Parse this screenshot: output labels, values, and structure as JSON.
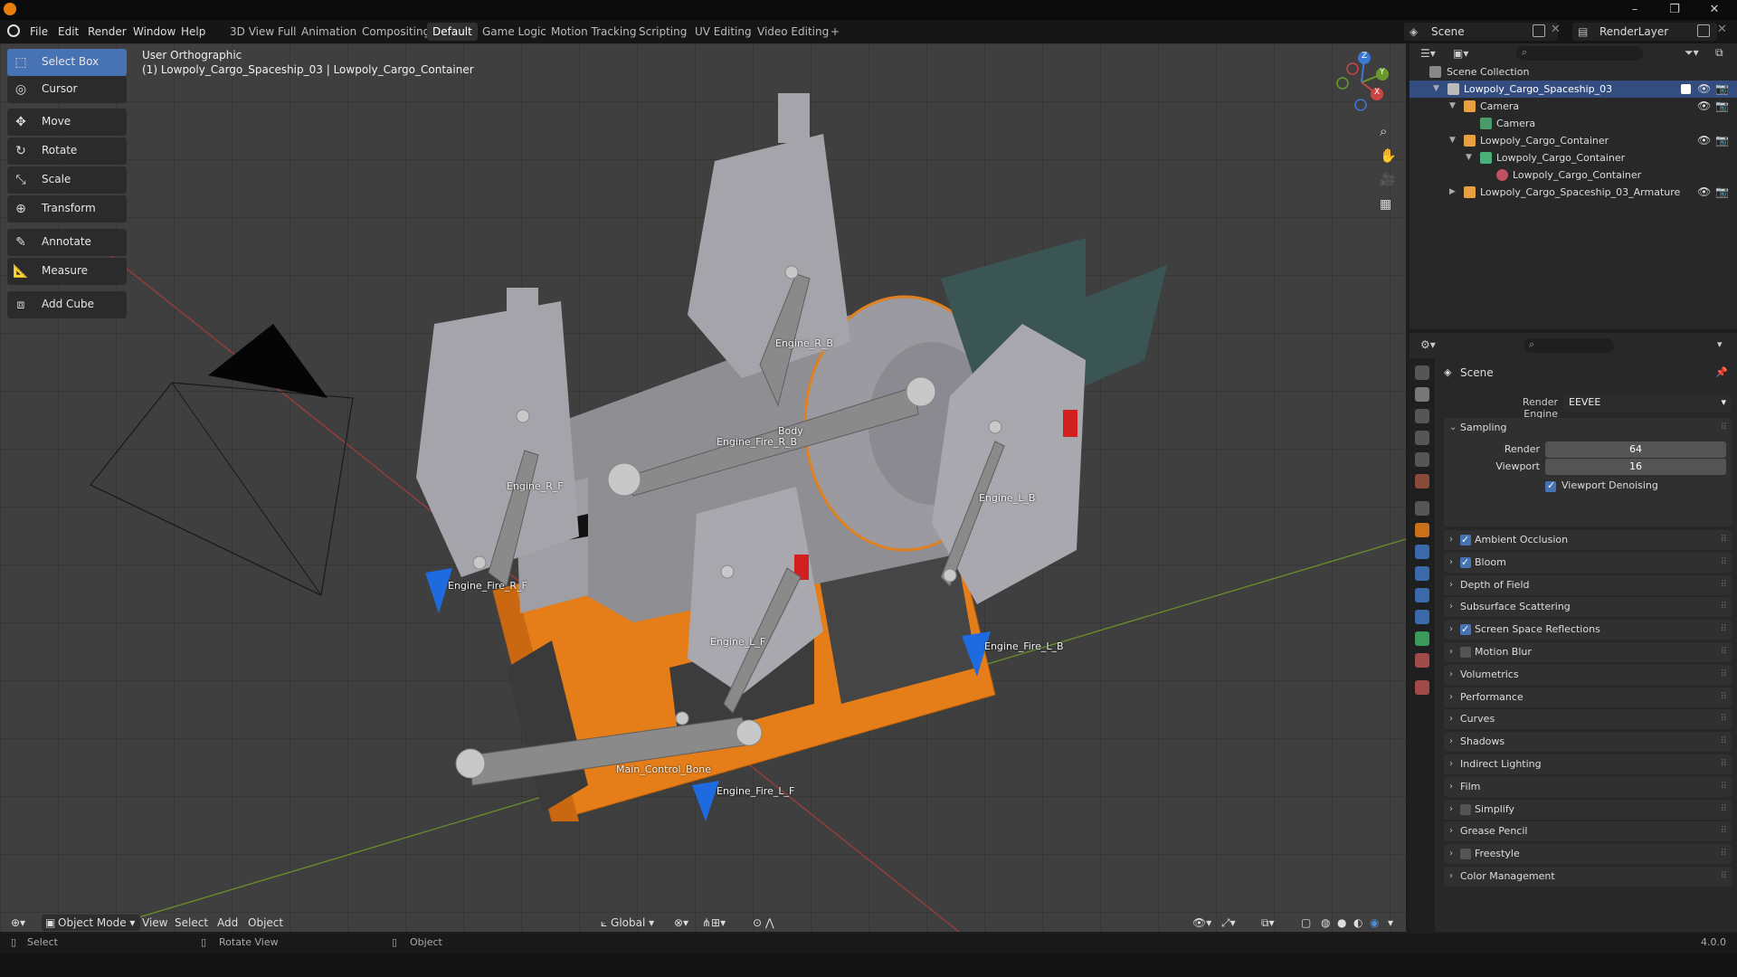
{
  "window": {
    "minimize": "–",
    "maximize": "❐",
    "close": "✕"
  },
  "menu": [
    "File",
    "Edit",
    "Render",
    "Window",
    "Help"
  ],
  "workspaces": [
    "3D View Full",
    "Animation",
    "Compositing",
    "Default",
    "Game Logic",
    "Motion Tracking",
    "Scripting",
    "UV Editing",
    "Video Editing"
  ],
  "active_workspace": "Default",
  "add_workspace": "+",
  "scene_selector": {
    "value": "Scene"
  },
  "view_layer": {
    "value": "RenderLayer"
  },
  "tools": {
    "select_box": "Select Box",
    "cursor": "Cursor",
    "move": "Move",
    "rotate": "Rotate",
    "scale": "Scale",
    "transform": "Transform",
    "annotate": "Annotate",
    "measure": "Measure",
    "add_cube": "Add Cube"
  },
  "viewport": {
    "view_name": "User Orthographic",
    "object_info": "(1) Lowpoly_Cargo_Spaceship_03 | Lowpoly_Cargo_Container",
    "gizmo": {
      "x": "X",
      "y": "Y",
      "z": "Z"
    },
    "bones": {
      "engine_r_b": "Engine_R_B",
      "body": "Body",
      "engine_fire_r_b": "Engine_Fire_R_B",
      "engine_r_f": "Engine_R_F",
      "engine_l_b": "Engine_L_B",
      "engine_fire_r_f": "Engine_Fire_R_F",
      "engine_l_f": "Engine_L_F",
      "engine_fire_l_b": "Engine_Fire_L_B",
      "main_control_bone": "Main_Control_Bone",
      "engine_fire_l_f": "Engine_Fire_L_F"
    }
  },
  "viewport_header": {
    "mode": "Object Mode",
    "view": "View",
    "select": "Select",
    "add": "Add",
    "object": "Object",
    "orientation": "Global"
  },
  "status": {
    "select": "Select",
    "rotate_view": "Rotate View",
    "object": "Object",
    "version": "4.0.0"
  },
  "outliner": {
    "root": "Scene Collection",
    "items": [
      {
        "label": "Lowpoly_Cargo_Spaceship_03"
      },
      {
        "label": "Camera"
      },
      {
        "label": "Camera"
      },
      {
        "label": "Lowpoly_Cargo_Container"
      },
      {
        "label": "Lowpoly_Cargo_Container"
      },
      {
        "label": "Lowpoly_Cargo_Container"
      },
      {
        "label": "Lowpoly_Cargo_Spaceship_03_Armature"
      }
    ]
  },
  "properties": {
    "context": "Scene",
    "render_engine_label": "Render Engine",
    "render_engine_value": "EEVEE",
    "sampling": {
      "title": "Sampling",
      "render_label": "Render",
      "render_value": "64",
      "viewport_label": "Viewport",
      "viewport_value": "16",
      "denoise_label": "Viewport Denoising"
    },
    "panels": [
      {
        "label": "Ambient Occlusion",
        "checkbox": true,
        "checked": true
      },
      {
        "label": "Bloom",
        "checkbox": true,
        "checked": true
      },
      {
        "label": "Depth of Field",
        "checkbox": false,
        "checked": false
      },
      {
        "label": "Subsurface Scattering",
        "checkbox": false,
        "checked": false
      },
      {
        "label": "Screen Space Reflections",
        "checkbox": true,
        "checked": true
      },
      {
        "label": "Motion Blur",
        "checkbox": true,
        "checked": false
      },
      {
        "label": "Volumetrics",
        "checkbox": false,
        "checked": false
      },
      {
        "label": "Performance",
        "checkbox": false,
        "checked": false
      },
      {
        "label": "Curves",
        "checkbox": false,
        "checked": false
      },
      {
        "label": "Shadows",
        "checkbox": false,
        "checked": false
      },
      {
        "label": "Indirect Lighting",
        "checkbox": false,
        "checked": false
      },
      {
        "label": "Film",
        "checkbox": false,
        "checked": false
      },
      {
        "label": "Simplify",
        "checkbox": true,
        "checked": false
      },
      {
        "label": "Grease Pencil",
        "checkbox": false,
        "checked": false
      },
      {
        "label": "Freestyle",
        "checkbox": true,
        "checked": false
      },
      {
        "label": "Color Management",
        "checkbox": false,
        "checked": false
      }
    ]
  },
  "colors": {
    "accent": "#4772b3",
    "orange": "#e57e18",
    "selection": "#334d80"
  }
}
